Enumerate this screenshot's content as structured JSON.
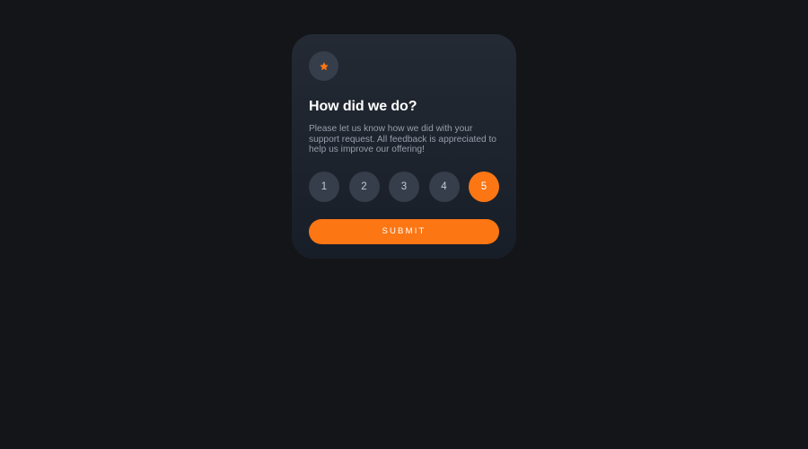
{
  "card": {
    "icon": "star-icon",
    "title": "How did we do?",
    "description": "Please let us know how we did with your support request. All feedback is appreciated to help us improve our offering!",
    "ratings": [
      "1",
      "2",
      "3",
      "4",
      "5"
    ],
    "selected_rating": "5",
    "submit_label": "SUBMIT"
  },
  "colors": {
    "page_background": "#131518",
    "card_background": "#1f2630",
    "accent": "#fc7614",
    "rating_background": "#363e4b",
    "muted_text": "#959eac"
  }
}
